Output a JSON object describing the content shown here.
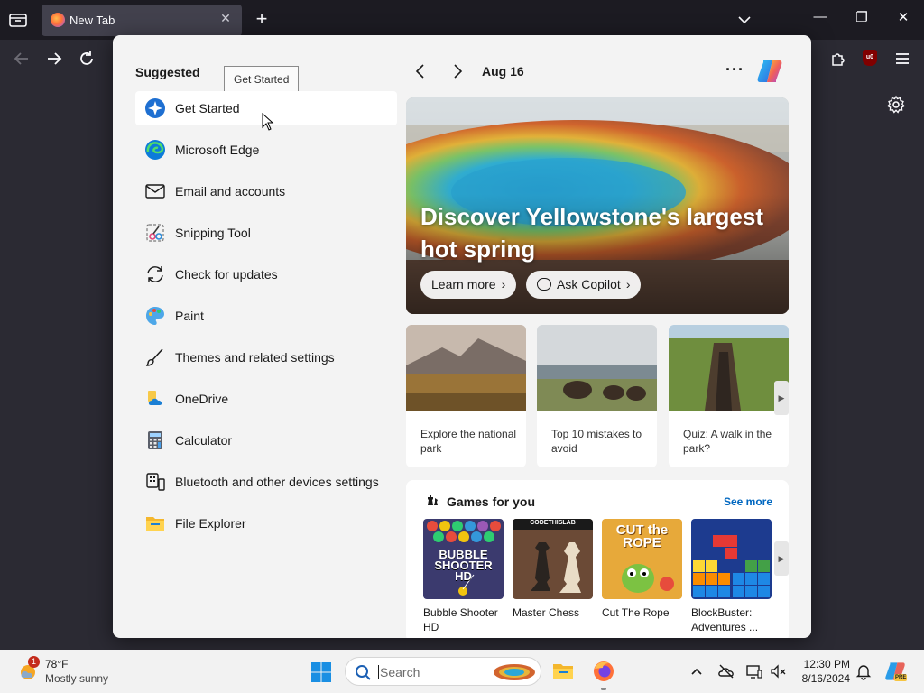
{
  "browser": {
    "tab_title": "New Tab",
    "tab_close": "✕",
    "new_tab": "+",
    "window_controls": [
      "—",
      "❐",
      "✕"
    ],
    "ublock_label": "u0"
  },
  "start": {
    "suggested_title": "Suggested",
    "tooltip": "Get Started",
    "apps": [
      {
        "label": "Get Started",
        "icon": "get-started-icon"
      },
      {
        "label": "Microsoft Edge",
        "icon": "edge-icon"
      },
      {
        "label": "Email and accounts",
        "icon": "mail-icon"
      },
      {
        "label": "Snipping Tool",
        "icon": "snipping-tool-icon"
      },
      {
        "label": "Check for updates",
        "icon": "refresh-icon"
      },
      {
        "label": "Paint",
        "icon": "paint-icon"
      },
      {
        "label": "Themes and related settings",
        "icon": "brush-icon"
      },
      {
        "label": "OneDrive",
        "icon": "onedrive-icon"
      },
      {
        "label": "Calculator",
        "icon": "calculator-icon"
      },
      {
        "label": "Bluetooth and other devices settings",
        "icon": "devices-icon"
      },
      {
        "label": "File Explorer",
        "icon": "folder-icon"
      }
    ]
  },
  "feed": {
    "date": "Aug 16",
    "more": "···",
    "hero": {
      "title": "Discover Yellowstone's largest hot spring",
      "learn_more": "Learn more",
      "ask_copilot": "Ask Copilot"
    },
    "cards": [
      {
        "text": "Explore the national park"
      },
      {
        "text": "Top 10 mistakes to avoid"
      },
      {
        "text": "Quiz: A walk in the park?"
      }
    ],
    "games": {
      "title": "Games for you",
      "see_more": "See more",
      "items": [
        {
          "name": "Bubble Shooter HD",
          "thumb_text": "BUBBLE SHOOTER HD"
        },
        {
          "name": "Master Chess",
          "thumb_text": "CODETHISLAB"
        },
        {
          "name": "Cut The Rope",
          "thumb_text": "CUT the ROPE"
        },
        {
          "name": "BlockBuster: Adventures ...",
          "thumb_text": ""
        }
      ]
    }
  },
  "taskbar": {
    "weather_badge": "1",
    "temperature": "78°F",
    "condition": "Mostly sunny",
    "search_placeholder": "Search",
    "time": "12:30 PM",
    "date": "8/16/2024",
    "copilot_badge": "PRE"
  },
  "colors": {
    "accent": "#0067c0",
    "panel_bg": "#f3f3f3",
    "browser_dark": "#1c1b22",
    "toolbar_dark": "#2b2a33"
  }
}
